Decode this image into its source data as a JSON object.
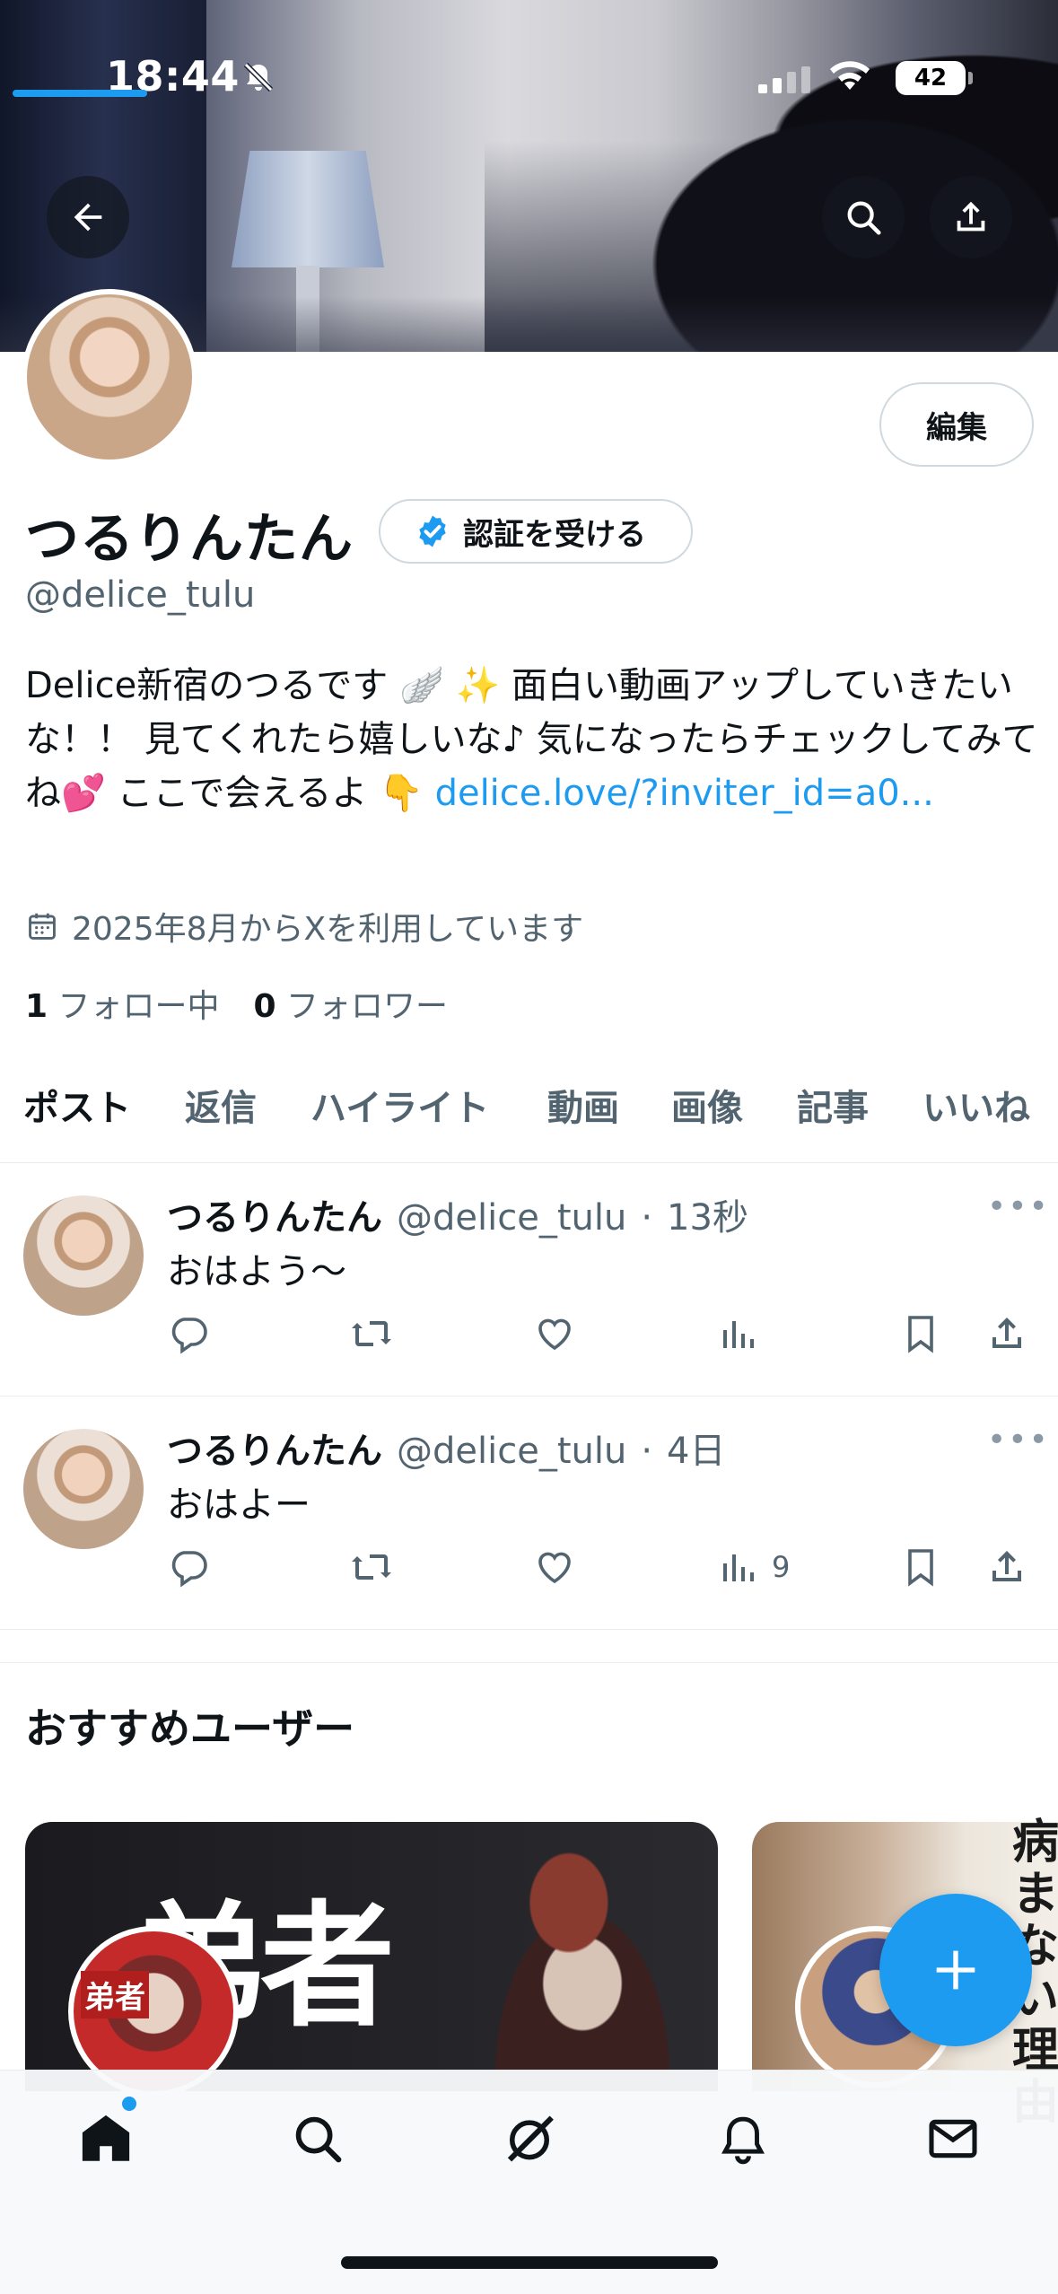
{
  "status_bar": {
    "time": "18:44",
    "battery": "42"
  },
  "profile": {
    "name": "つるりんたん",
    "handle": "@delice_tulu",
    "edit_label": "編集",
    "verify_label": "認証を受ける",
    "bio_text": "Delice新宿のつるです 🪽 ✨ 面白い動画アップしていきたいな！！ 見てくれたら嬉しいな♪ 気になったらチェックしてみてね💕 ここで会えるよ 👇 ",
    "bio_link": "delice.love/?inviter_id=a0...",
    "joined": "2025年8月からXを利用しています",
    "following_count": "1",
    "following_label": "フォロー中",
    "followers_count": "0",
    "followers_label": "フォロワー"
  },
  "tabs": [
    {
      "label": "ポスト"
    },
    {
      "label": "返信"
    },
    {
      "label": "ハイライト"
    },
    {
      "label": "動画"
    },
    {
      "label": "画像"
    },
    {
      "label": "記事"
    },
    {
      "label": "いいね"
    }
  ],
  "posts": [
    {
      "name": "つるりんたん",
      "handle": "@delice_tulu",
      "time": "13秒",
      "text": "おはよう〜",
      "views": ""
    },
    {
      "name": "つるりんたん",
      "handle": "@delice_tulu",
      "time": "4日",
      "text": "おはよー",
      "views": "9"
    }
  ],
  "recommended": {
    "title": "おすすめユーザー",
    "card1_banner_text": "弟者",
    "card1_avatar_text": "弟者",
    "card2_banner_text": "病まない理由"
  },
  "icons": {
    "back": "arrow-left-icon",
    "search": "search-icon",
    "share": "share-icon",
    "calendar": "calendar-icon",
    "verified": "verified-badge-icon",
    "reply": "reply-icon",
    "repost": "repost-icon",
    "like": "heart-icon",
    "views": "views-icon",
    "bookmark": "bookmark-icon",
    "compose": "plus-icon",
    "nav_home": "home-icon",
    "nav_search": "search-icon",
    "nav_grok": "grok-icon",
    "nav_notifications": "bell-icon",
    "nav_messages": "mail-icon"
  },
  "colors": {
    "accent": "#1d9bf0",
    "text": "#0f1419",
    "muted": "#536471"
  }
}
